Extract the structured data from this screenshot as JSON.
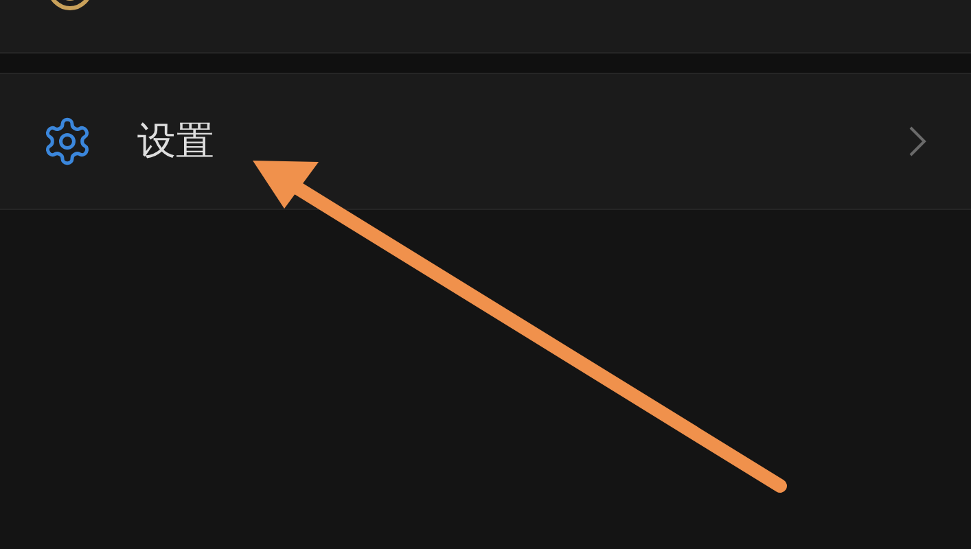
{
  "menu_items": [
    {
      "label": "设置"
    }
  ]
}
